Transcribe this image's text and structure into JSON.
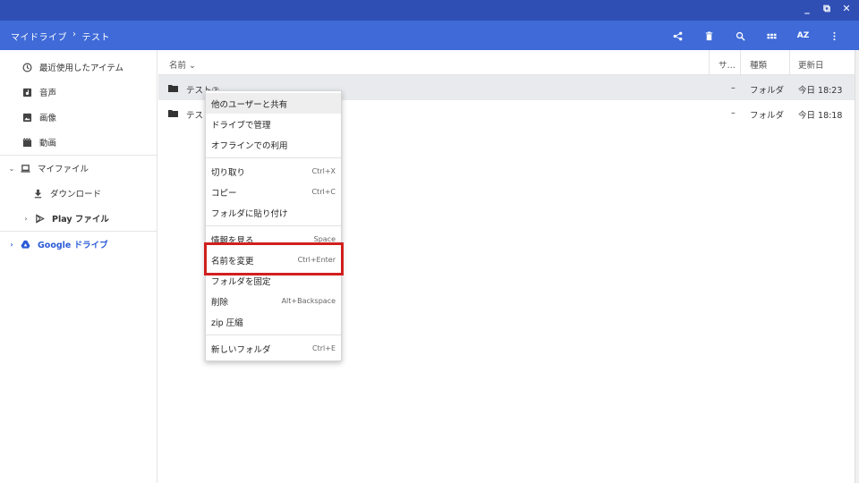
{
  "window": {
    "buttons": [
      {
        "name": "minimize",
        "glyph": "_"
      },
      {
        "name": "restore",
        "glyph": "⧉"
      },
      {
        "name": "close",
        "glyph": "✕"
      }
    ]
  },
  "breadcrumb": {
    "root": "マイドライブ",
    "separator": "›",
    "current": "テスト"
  },
  "toolbar": {
    "icons": [
      "share-icon",
      "delete-icon",
      "search-icon",
      "grid-view-icon",
      "sort-icon",
      "more-menu-icon"
    ],
    "sort_label": "AZ"
  },
  "sidebar": {
    "items": [
      {
        "label": "最近使用したアイテム",
        "icon": "clock-icon"
      },
      {
        "label": "音声",
        "icon": "audio-icon"
      },
      {
        "label": "画像",
        "icon": "image-icon"
      },
      {
        "label": "動画",
        "icon": "video-icon"
      },
      {
        "label": "マイファイル",
        "icon": "laptop-icon",
        "expander": "⌄"
      },
      {
        "label": "ダウンロード",
        "icon": "download-icon"
      },
      {
        "label": "Play ファイル",
        "icon": "play-icon",
        "expander": "›"
      },
      {
        "label": "Google ドライブ",
        "icon": "drive-icon",
        "expander": "›"
      }
    ]
  },
  "table": {
    "columns": {
      "name": "名前",
      "sort_arrow": "⌄",
      "size": "サ…",
      "type": "種類",
      "modified": "更新日"
    },
    "rows": [
      {
        "name": "テスト③",
        "size": "–",
        "type": "フォルダ",
        "modified": "今日 18:23"
      },
      {
        "name": "テスト",
        "size": "–",
        "type": "フォルダ",
        "modified": "今日 18:18"
      }
    ]
  },
  "context_menu": {
    "groups": [
      [
        {
          "label": "他のユーザーと共有",
          "shortcut": ""
        },
        {
          "label": "ドライブで管理",
          "shortcut": ""
        },
        {
          "label": "オフラインでの利用",
          "shortcut": ""
        }
      ],
      [
        {
          "label": "切り取り",
          "shortcut": "Ctrl+X"
        },
        {
          "label": "コピー",
          "shortcut": "Ctrl+C"
        },
        {
          "label": "フォルダに貼り付け",
          "shortcut": ""
        }
      ],
      [
        {
          "label": "情報を見る",
          "shortcut": "Space"
        },
        {
          "label": "名前を変更",
          "shortcut": "Ctrl+Enter"
        },
        {
          "label": "フォルダを固定",
          "shortcut": ""
        },
        {
          "label": "削除",
          "shortcut": "Alt+Backspace"
        },
        {
          "label": "zip 圧縮",
          "shortcut": ""
        }
      ],
      [
        {
          "label": "新しいフォルダ",
          "shortcut": "Ctrl+E"
        }
      ]
    ]
  },
  "colors": {
    "titlebar": "#2f4fb5",
    "appbar": "#3f6ad8",
    "highlight": "#d0201e",
    "drive_link": "#2a5bd7"
  }
}
